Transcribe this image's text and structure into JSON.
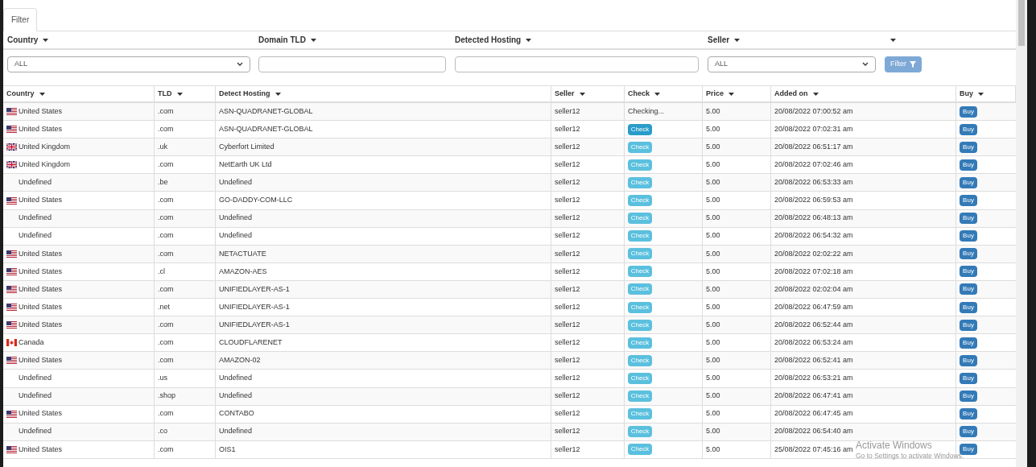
{
  "tabs": [
    {
      "label": "Filter",
      "selected": true
    }
  ],
  "filters": [
    {
      "label": "Country",
      "kind": "select",
      "value": "ALL"
    },
    {
      "label": "Domain TLD",
      "kind": "input"
    },
    {
      "label": "Detected Hosting",
      "kind": "input"
    },
    {
      "label": "Seller",
      "kind": "select",
      "value": "ALL"
    },
    {
      "kind": "button",
      "label": "Filter"
    }
  ],
  "table": {
    "columns": [
      "Country",
      "TLD",
      "Detect Hosting",
      "Seller",
      "Check",
      "Price",
      "Added on",
      "Buy"
    ],
    "rows": [
      {
        "country": "United States",
        "kind": "us",
        "tld": ".com",
        "hosting": "ASN-QUADRANET-GLOBAL",
        "seller": "seller12",
        "check": {
          "kind": "status",
          "label": "Checking..."
        },
        "price": "5.00",
        "added": "20/08/2022 07:00:52 am",
        "buy": "Buy"
      },
      {
        "country": "United States",
        "kind": "us",
        "tld": ".com",
        "hosting": "ASN-QUADRANET-GLOBAL",
        "seller": "seller12",
        "check": {
          "kind": "button",
          "label": "Check",
          "hover": true
        },
        "price": "5.00",
        "added": "20/08/2022 07:02:31 am",
        "buy": "Buy"
      },
      {
        "country": "United Kingdom",
        "kind": "gb",
        "tld": ".uk",
        "hosting": "Cyberfort Limited",
        "seller": "seller12",
        "check": {
          "kind": "button",
          "label": "Check",
          "hover": false
        },
        "price": "5.00",
        "added": "20/08/2022 06:51:17 am",
        "buy": "Buy"
      },
      {
        "country": "United Kingdom",
        "kind": "gb",
        "tld": ".com",
        "hosting": "NetEarth UK Ltd",
        "seller": "seller12",
        "check": {
          "kind": "button",
          "label": "Check",
          "hover": false
        },
        "price": "5.00",
        "added": "20/08/2022 07:02:46 am",
        "buy": "Buy"
      },
      {
        "country": "Undefined",
        "kind": "none",
        "tld": ".be",
        "hosting": "Undefined",
        "seller": "seller12",
        "check": {
          "kind": "button",
          "label": "Check",
          "hover": false
        },
        "price": "5.00",
        "added": "20/08/2022 06:53:33 am",
        "buy": "Buy"
      },
      {
        "country": "United States",
        "kind": "us",
        "tld": ".com",
        "hosting": "GO-DADDY-COM-LLC",
        "seller": "seller12",
        "check": {
          "kind": "button",
          "label": "Check",
          "hover": false
        },
        "price": "5.00",
        "added": "20/08/2022 06:59:53 am",
        "buy": "Buy"
      },
      {
        "country": "Undefined",
        "kind": "none",
        "tld": ".com",
        "hosting": "Undefined",
        "seller": "seller12",
        "check": {
          "kind": "button",
          "label": "Check",
          "hover": false
        },
        "price": "5.00",
        "added": "20/08/2022 06:48:13 am",
        "buy": "Buy"
      },
      {
        "country": "Undefined",
        "kind": "none",
        "tld": ".com",
        "hosting": "Undefined",
        "seller": "seller12",
        "check": {
          "kind": "button",
          "label": "Check",
          "hover": false
        },
        "price": "5.00",
        "added": "20/08/2022 06:54:32 am",
        "buy": "Buy"
      },
      {
        "country": "United States",
        "kind": "us",
        "tld": ".com",
        "hosting": "NETACTUATE",
        "seller": "seller12",
        "check": {
          "kind": "button",
          "label": "Check",
          "hover": false
        },
        "price": "5.00",
        "added": "20/08/2022 02:02:22 am",
        "buy": "Buy"
      },
      {
        "country": "United States",
        "kind": "us",
        "tld": ".cl",
        "hosting": "AMAZON-AES",
        "seller": "seller12",
        "check": {
          "kind": "button",
          "label": "Check",
          "hover": false
        },
        "price": "5.00",
        "added": "20/08/2022 07:02:18 am",
        "buy": "Buy"
      },
      {
        "country": "United States",
        "kind": "us",
        "tld": ".com",
        "hosting": "UNIFIEDLAYER-AS-1",
        "seller": "seller12",
        "check": {
          "kind": "button",
          "label": "Check",
          "hover": false
        },
        "price": "5.00",
        "added": "20/08/2022 02:02:04 am",
        "buy": "Buy"
      },
      {
        "country": "United States",
        "kind": "us",
        "tld": ".net",
        "hosting": "UNIFIEDLAYER-AS-1",
        "seller": "seller12",
        "check": {
          "kind": "button",
          "label": "Check",
          "hover": false
        },
        "price": "5.00",
        "added": "20/08/2022 06:47:59 am",
        "buy": "Buy"
      },
      {
        "country": "United States",
        "kind": "us",
        "tld": ".com",
        "hosting": "UNIFIEDLAYER-AS-1",
        "seller": "seller12",
        "check": {
          "kind": "button",
          "label": "Check",
          "hover": false
        },
        "price": "5.00",
        "added": "20/08/2022 06:52:44 am",
        "buy": "Buy"
      },
      {
        "country": "Canada",
        "kind": "ca",
        "tld": ".com",
        "hosting": "CLOUDFLARENET",
        "seller": "seller12",
        "check": {
          "kind": "button",
          "label": "Check",
          "hover": false
        },
        "price": "5.00",
        "added": "20/08/2022 06:53:24 am",
        "buy": "Buy"
      },
      {
        "country": "United States",
        "kind": "us",
        "tld": ".com",
        "hosting": "AMAZON-02",
        "seller": "seller12",
        "check": {
          "kind": "button",
          "label": "Check",
          "hover": false
        },
        "price": "5.00",
        "added": "20/08/2022 06:52:41 am",
        "buy": "Buy"
      },
      {
        "country": "Undefined",
        "kind": "none",
        "tld": ".us",
        "hosting": "Undefined",
        "seller": "seller12",
        "check": {
          "kind": "button",
          "label": "Check",
          "hover": false
        },
        "price": "5.00",
        "added": "20/08/2022 06:53:21 am",
        "buy": "Buy"
      },
      {
        "country": "Undefined",
        "kind": "none",
        "tld": ".shop",
        "hosting": "Undefined",
        "seller": "seller12",
        "check": {
          "kind": "button",
          "label": "Check",
          "hover": false
        },
        "price": "5.00",
        "added": "20/08/2022 06:47:41 am",
        "buy": "Buy"
      },
      {
        "country": "United States",
        "kind": "us",
        "tld": ".com",
        "hosting": "CONTABO",
        "seller": "seller12",
        "check": {
          "kind": "button",
          "label": "Check",
          "hover": false
        },
        "price": "5.00",
        "added": "20/08/2022 06:47:45 am",
        "buy": "Buy"
      },
      {
        "country": "Undefined",
        "kind": "none",
        "tld": ".co",
        "hosting": "Undefined",
        "seller": "seller12",
        "check": {
          "kind": "button",
          "label": "Check",
          "hover": false
        },
        "price": "5.00",
        "added": "20/08/2022 06:54:40 am",
        "buy": "Buy"
      },
      {
        "country": "United States",
        "kind": "us",
        "tld": ".com",
        "hosting": "OIS1",
        "seller": "seller12",
        "check": {
          "kind": "button",
          "label": "Check",
          "hover": false
        },
        "price": "5.00",
        "added": "25/08/2022 07:45:16 am",
        "buy": "Buy"
      }
    ]
  },
  "os_notice": {
    "title": "Activate Windows",
    "text": "Go to Settings to activate Windows."
  }
}
